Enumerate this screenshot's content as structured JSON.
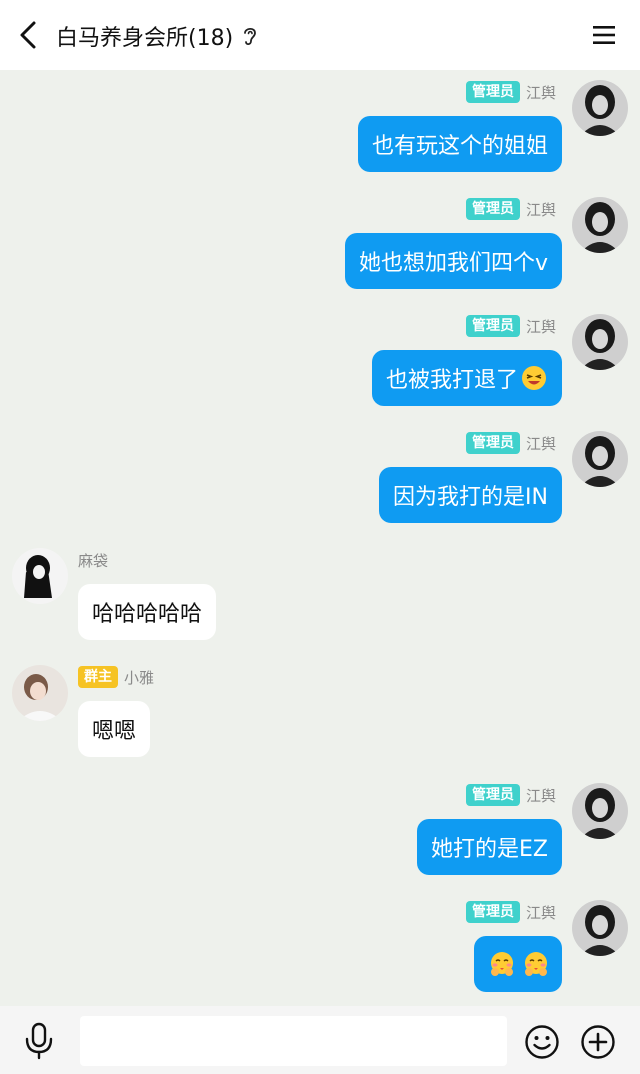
{
  "header": {
    "title": "白马养身会所(18)",
    "back_icon": "chevron-left-icon",
    "mode_icon": "ear-icon",
    "menu_icon": "hamburger-menu-icon"
  },
  "badges": {
    "admin": "管理员",
    "owner": "群主"
  },
  "messages": [
    {
      "side": "right",
      "sender": "江舆",
      "badge": "管理员",
      "text": "也有玩这个的姐姐"
    },
    {
      "side": "right",
      "sender": "江舆",
      "badge": "管理员",
      "text": "她也想加我们四个v"
    },
    {
      "side": "right",
      "sender": "江舆",
      "badge": "管理员",
      "text": "也被我打退了",
      "emoji": "laughing-face-emoji"
    },
    {
      "side": "right",
      "sender": "江舆",
      "badge": "管理员",
      "text": "因为我打的是IN"
    },
    {
      "side": "left",
      "sender": "麻袋",
      "badge": "",
      "text": "哈哈哈哈哈"
    },
    {
      "side": "left",
      "sender": "小雅",
      "badge": "群主",
      "text": "嗯嗯"
    },
    {
      "side": "right",
      "sender": "江舆",
      "badge": "管理员",
      "text": "她打的是EZ"
    },
    {
      "side": "right",
      "sender": "江舆",
      "badge": "管理员",
      "text": "",
      "emoji": "hugging-face-emoji x2"
    }
  ],
  "footer": {
    "input_value": "",
    "mic_icon": "microphone-icon",
    "emoji_icon": "smiley-icon",
    "plus_icon": "plus-circle-icon"
  },
  "colors": {
    "background": "#eef1ec",
    "my_bubble": "#0f9bf2",
    "their_bubble": "#ffffff",
    "admin_badge": "#3fd1cc",
    "owner_badge": "#f6c324"
  }
}
